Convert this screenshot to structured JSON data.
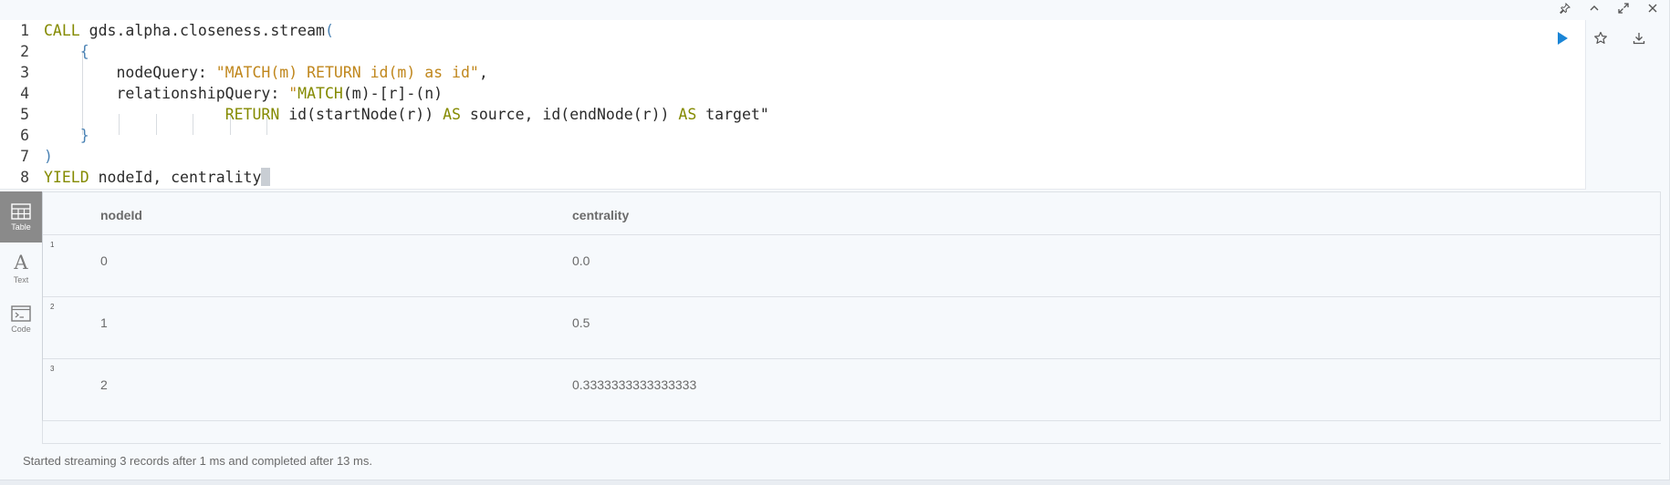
{
  "editor": {
    "lines": [
      {
        "num": "1",
        "segments": [
          [
            "kw",
            "CALL"
          ],
          [
            "plain",
            " gds.alpha.closeness.stream"
          ],
          [
            "punc",
            "("
          ]
        ]
      },
      {
        "num": "2",
        "segments": [
          [
            "plain",
            "    "
          ],
          [
            "punc",
            "{"
          ]
        ]
      },
      {
        "num": "3",
        "segments": [
          [
            "plain",
            "        nodeQuery: "
          ],
          [
            "str",
            "\"MATCH(m) RETURN id(m) as id\""
          ],
          [
            "plain",
            ","
          ]
        ]
      },
      {
        "num": "4",
        "segments": [
          [
            "plain",
            "        relationshipQuery: "
          ],
          [
            "str",
            "\""
          ],
          [
            "kw",
            "MATCH"
          ],
          [
            "plain",
            "(m)-[r]-(n)"
          ]
        ]
      },
      {
        "num": "5",
        "segments": [
          [
            "plain",
            "                    "
          ],
          [
            "kw",
            "RETURN"
          ],
          [
            "plain",
            " id(startNode(r)) "
          ],
          [
            "kw",
            "AS"
          ],
          [
            "plain",
            " source, id(endNode(r)) "
          ],
          [
            "kw",
            "AS"
          ],
          [
            "plain",
            " target\""
          ]
        ]
      },
      {
        "num": "6",
        "segments": [
          [
            "plain",
            "    "
          ],
          [
            "punc",
            "}"
          ]
        ]
      },
      {
        "num": "7",
        "segments": [
          [
            "punc",
            ")"
          ]
        ]
      },
      {
        "num": "8",
        "segments": [
          [
            "kw",
            "YIELD"
          ],
          [
            "plain",
            " nodeId, centrality"
          ]
        ]
      }
    ]
  },
  "sidebar": {
    "tabs": [
      {
        "label": "Table",
        "icon": "table-icon",
        "active": true
      },
      {
        "label": "Text",
        "icon": "text-icon",
        "active": false
      },
      {
        "label": "Code",
        "icon": "code-icon",
        "active": false
      }
    ]
  },
  "table": {
    "columns": [
      "nodeId",
      "centrality"
    ],
    "rows": [
      {
        "index": "1",
        "nodeId": "0",
        "centrality": "0.0"
      },
      {
        "index": "2",
        "nodeId": "1",
        "centrality": "0.5"
      },
      {
        "index": "3",
        "nodeId": "2",
        "centrality": "0.3333333333333333"
      }
    ]
  },
  "status": {
    "message": "Started streaming 3 records after 1 ms and completed after 13 ms."
  },
  "colors": {
    "run": "#1a85d6",
    "keyword": "#848a00",
    "string": "#c0871d",
    "punctuation": "#4a82b4"
  },
  "icons": {
    "window": [
      "pin-icon",
      "collapse-icon",
      "expand-icon",
      "close-icon"
    ],
    "editor": [
      "run-icon",
      "favorite-star-icon",
      "download-icon"
    ]
  }
}
